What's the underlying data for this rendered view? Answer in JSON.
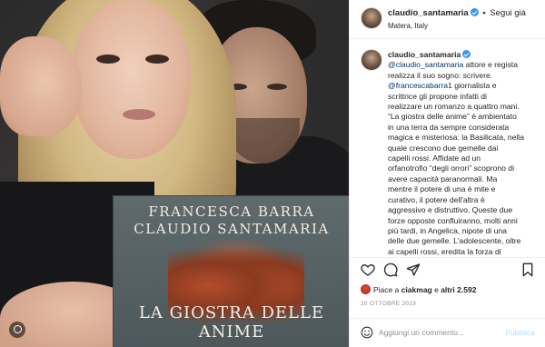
{
  "post": {
    "username": "claudio_santamaria",
    "follow_label": "Segui già",
    "separator": "•",
    "location": "Matera, Italy"
  },
  "book": {
    "author_1": "FRANCESCA BARRA",
    "author_2": "CLAUDIO SANTAMARIA",
    "title": "LA GIOSTRA DELLE ANIME"
  },
  "caption": {
    "username": "claudio_santamaria",
    "lines": [
      {
        "mention": "@claudio_santamaria",
        "text": " attore e regista"
      },
      {
        "mention": "",
        "text": "realizza il suo sogno: scrivere."
      },
      {
        "mention": "@francescabarra1",
        "text": " giornalista e"
      },
      {
        "mention": "",
        "text": "scrittrice gli propone infatti di"
      },
      {
        "mention": "",
        "text": "realizzare un romanzo a quattro mani."
      },
      {
        "mention": "",
        "text": "“La giostra delle anime” è ambientato"
      },
      {
        "mention": "",
        "text": "in una terra da sempre considerata"
      },
      {
        "mention": "",
        "text": "magica e misteriosa: la Basilicata, nella"
      },
      {
        "mention": "",
        "text": "quale crescono due gemelle dai"
      },
      {
        "mention": "",
        "text": "capelli rossi. Affidate ad un"
      },
      {
        "mention": "",
        "text": "orfanotrofio “degli orrori” scoprono di"
      },
      {
        "mention": "",
        "text": "avere capacità paranormali. Ma"
      },
      {
        "mention": "",
        "text": "mentre il potere di una è mite e"
      },
      {
        "mention": "",
        "text": "curativo, il potere dell'altra è"
      },
      {
        "mention": "",
        "text": "aggressivo e distruttivo. Queste due"
      },
      {
        "mention": "",
        "text": "forze opposte confluiranno, molti anni"
      },
      {
        "mention": "",
        "text": "più tardi, in Angelica, nipote di una"
      },
      {
        "mention": "",
        "text": "delle due gemelle. L'adolescente, oltre"
      },
      {
        "mention": "",
        "text": "ai capelli rossi, eredita la forza di"
      }
    ]
  },
  "likes": {
    "prefix": "Piace a ",
    "first_user": "ciakmag",
    "middle": " e ",
    "others": "altri 2.592"
  },
  "date": "20 OTTOBRE 2019",
  "comment_box": {
    "placeholder": "Aggiungi un commento...",
    "publish_label": "Pubblica"
  },
  "icons": {
    "like": "heart-icon",
    "comment": "comment-icon",
    "share": "share-icon",
    "save": "bookmark-icon",
    "emoji": "emoji-icon",
    "tag": "user-tag-icon"
  },
  "colors": {
    "verified": "#3897f0",
    "mention": "#00376b",
    "publish_disabled": "#b2dffc"
  }
}
